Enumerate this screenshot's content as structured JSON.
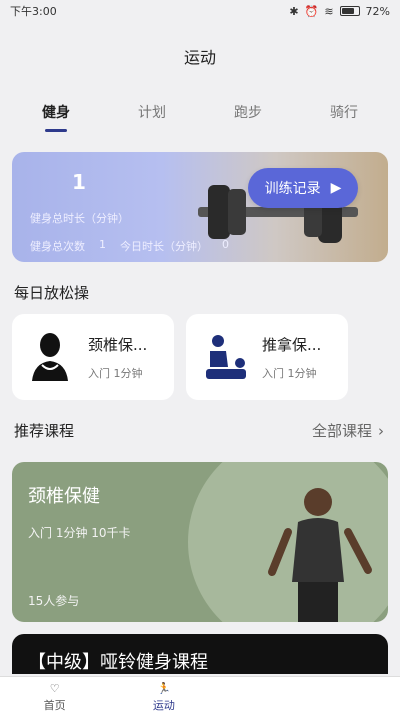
{
  "status": {
    "time": "下午3:00",
    "battery": "72%"
  },
  "header": {
    "title": "运动"
  },
  "tabs": [
    {
      "label": "健身"
    },
    {
      "label": "计划"
    },
    {
      "label": "跑步"
    },
    {
      "label": "骑行"
    }
  ],
  "banner": {
    "total_duration_value": "1",
    "total_duration_label": "健身总时长（分钟）",
    "total_count_label": "健身总次数",
    "total_count_value": "1",
    "today_label": "今日时长（分钟）",
    "today_value": "0",
    "record_button": "训练记录"
  },
  "daily_relax": {
    "title": "每日放松操",
    "cards": [
      {
        "title": "颈椎保...",
        "meta": "入门 1分钟",
        "icon": "neck-icon"
      },
      {
        "title": "推拿保...",
        "meta": "入门 1分钟",
        "icon": "massage-icon"
      }
    ]
  },
  "recommended": {
    "title": "推荐课程",
    "all_courses": "全部课程",
    "courses": [
      {
        "title": "颈椎保健",
        "meta": "入门 1分钟 10千卡",
        "participants": "15人参与",
        "color": "#8b9f7f"
      },
      {
        "title": "【中级】哑铃健身课程"
      }
    ]
  },
  "bottom_nav": [
    {
      "label": "首页",
      "icon": "heart-icon"
    },
    {
      "label": "运动",
      "icon": "running-icon"
    }
  ],
  "colors": {
    "accent": "#2e3a8c",
    "button": "#5a67d8"
  }
}
